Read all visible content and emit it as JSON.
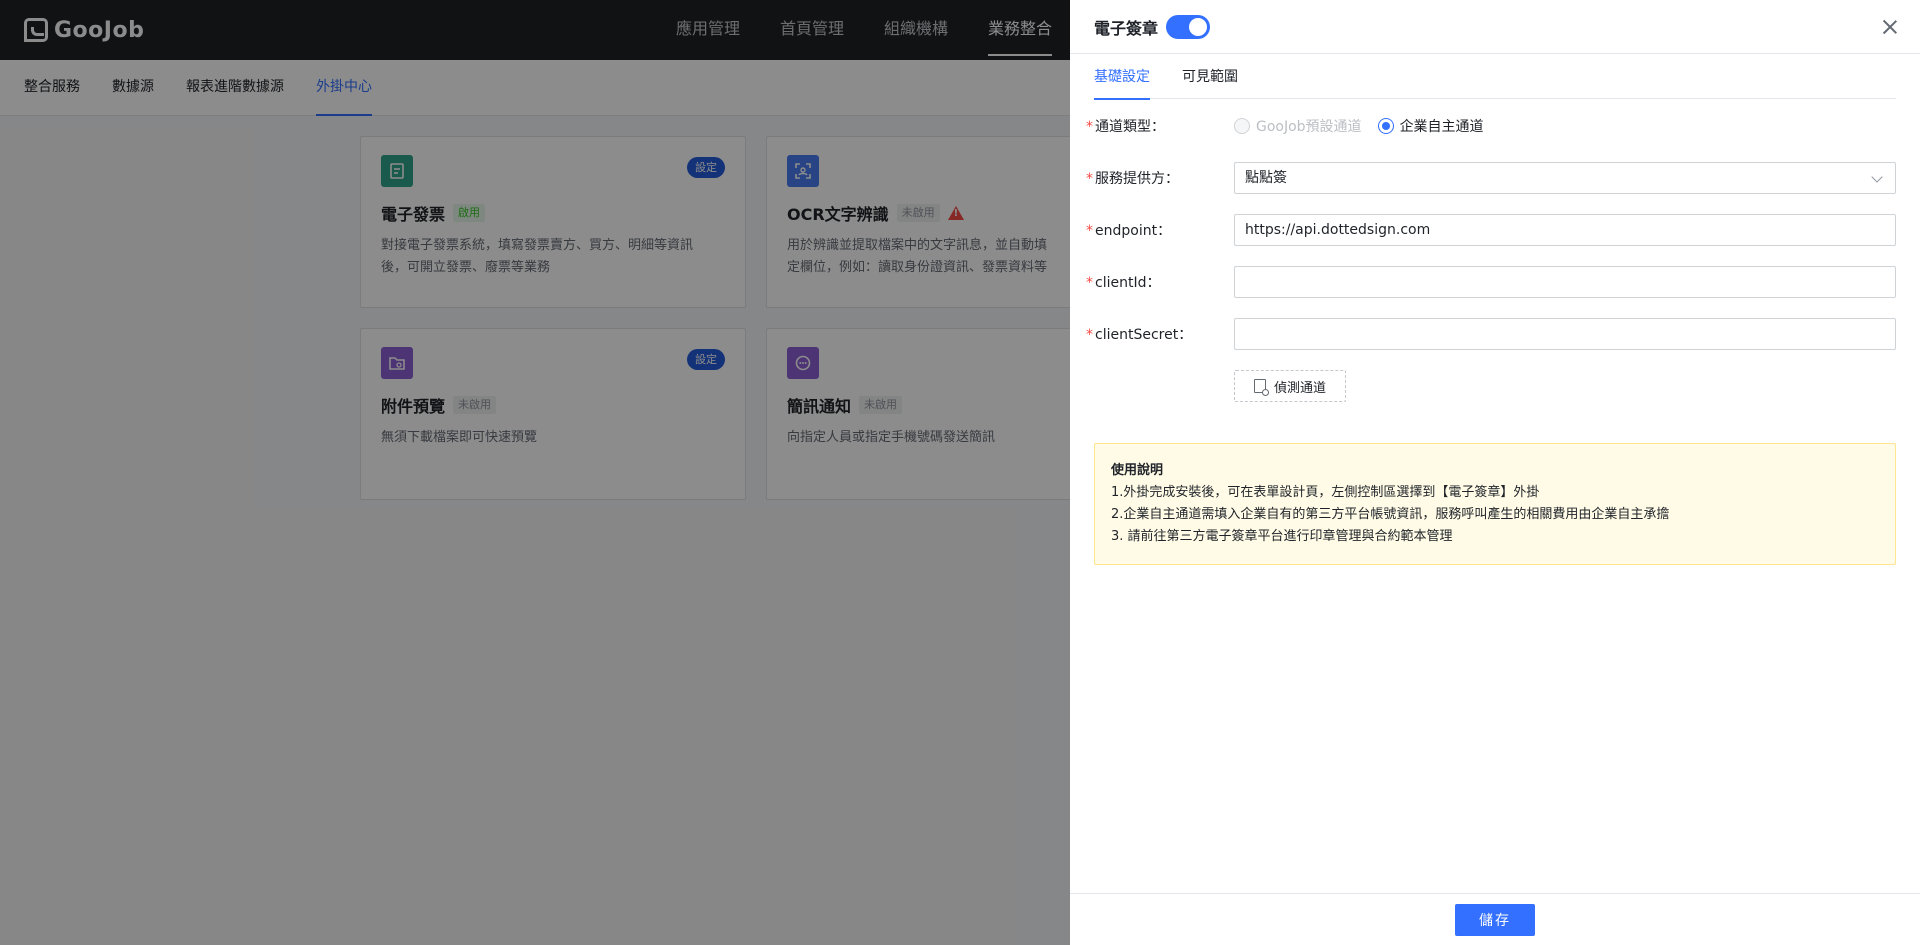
{
  "app": {
    "logo_text": "GooJob"
  },
  "topnav": {
    "items": [
      {
        "label": "應用管理"
      },
      {
        "label": "首頁管理"
      },
      {
        "label": "組織機構"
      },
      {
        "label": "業務整合"
      }
    ],
    "active_index": 3
  },
  "subnav": {
    "items": [
      {
        "label": "整合服務"
      },
      {
        "label": "數據源"
      },
      {
        "label": "報表進階數據源"
      },
      {
        "label": "外掛中心"
      }
    ],
    "active_index": 3
  },
  "cards": [
    {
      "title": "電子發票",
      "tag": "啟用",
      "badge": "設定",
      "desc1": "對接電子發票系統，填寫發票賣方、買方、明細等資訊",
      "desc2": "後，可開立發票、廢票等業務",
      "icon_color": "#2ea58a",
      "icon": "receipt-icon"
    },
    {
      "title": "OCR文字辨識",
      "tag": "未啟用",
      "badge": "",
      "desc1": "用於辨識並提取檔案中的文字訊息，並自動填",
      "desc2": "定欄位，例如：讀取身份證資訊、發票資料等",
      "icon_color": "#4a7cf0",
      "icon": "scan-icon"
    },
    {
      "title": "附件預覽",
      "tag": "未啟用",
      "badge": "設定",
      "desc1": "無須下載檔案即可快速預覽",
      "desc2": "",
      "icon_color": "#8c5fd6",
      "icon": "folder-icon"
    },
    {
      "title": "簡訊通知",
      "tag": "未啟用",
      "badge": "",
      "desc1": "向指定人員或指定手機號碼發送簡訊",
      "desc2": "",
      "icon_color": "#8c5fd6",
      "icon": "chat-icon"
    }
  ],
  "drawer": {
    "title": "電子簽章",
    "enabled": true,
    "tabs": [
      {
        "label": "基礎設定"
      },
      {
        "label": "可見範圍"
      }
    ],
    "active_tab": 0,
    "form": {
      "channel_type": {
        "label": "通道類型：",
        "options": [
          "GooJob預設通道",
          "企業自主通道"
        ],
        "selected": "企業自主通道"
      },
      "provider": {
        "label": "服務提供方：",
        "value": "點點簽"
      },
      "endpoint": {
        "label": "endpoint：",
        "value": "https://api.dottedsign.com"
      },
      "client_id": {
        "label": "clientId：",
        "value": ""
      },
      "client_secret": {
        "label": "clientSecret：",
        "value": ""
      },
      "detect_button": "偵測通道"
    },
    "note": {
      "title": "使用說明",
      "lines": [
        "1.外掛完成安裝後，可在表單設計頁，左側控制區選擇到【電子簽章】外掛",
        "2.企業自主通道需填入企業自有的第三方平台帳號資訊，服務呼叫產生的相關費用由企業自主承擔",
        "3. 請前往第三方電子簽章平台進行印章管理與合約範本管理"
      ]
    },
    "save_label": "儲存"
  },
  "colors": {
    "accent": "#3370ff",
    "topbar": "#1f2126",
    "required": "#f54a45",
    "note_bg": "#fffbe6"
  }
}
